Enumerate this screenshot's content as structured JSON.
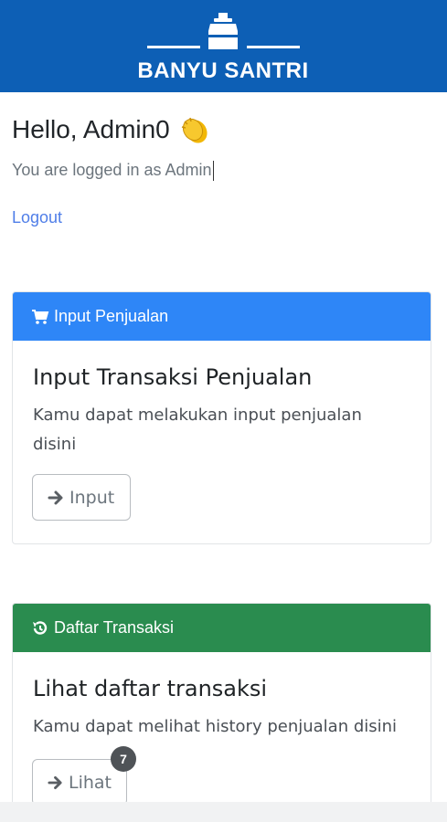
{
  "app": {
    "brand_name": "BANYU SANTRI",
    "brand_color": "#0d5fb5"
  },
  "user": {
    "greeting": "Hello, Admin0",
    "emoji_icon": "clapping-hands-icon",
    "logged_in_text": "You are logged in as Admin",
    "logout_label": "Logout"
  },
  "cards": {
    "input": {
      "header_label": "Input Penjualan",
      "header_icon": "shopping-cart-icon",
      "header_color": "#2e86f7",
      "title": "Input Transaksi Penjualan",
      "text": "Kamu dapat melakukan input penjualan disini",
      "button_label": "Input",
      "button_icon": "arrow-right-icon"
    },
    "list": {
      "header_label": "Daftar Transaksi",
      "header_icon": "history-icon",
      "header_color": "#2a8c4f",
      "title": "Lihat daftar transaksi",
      "text": "Kamu dapat melihat history penjualan disini",
      "button_label": "Lihat",
      "button_icon": "arrow-right-icon",
      "badge_count": "7"
    }
  }
}
